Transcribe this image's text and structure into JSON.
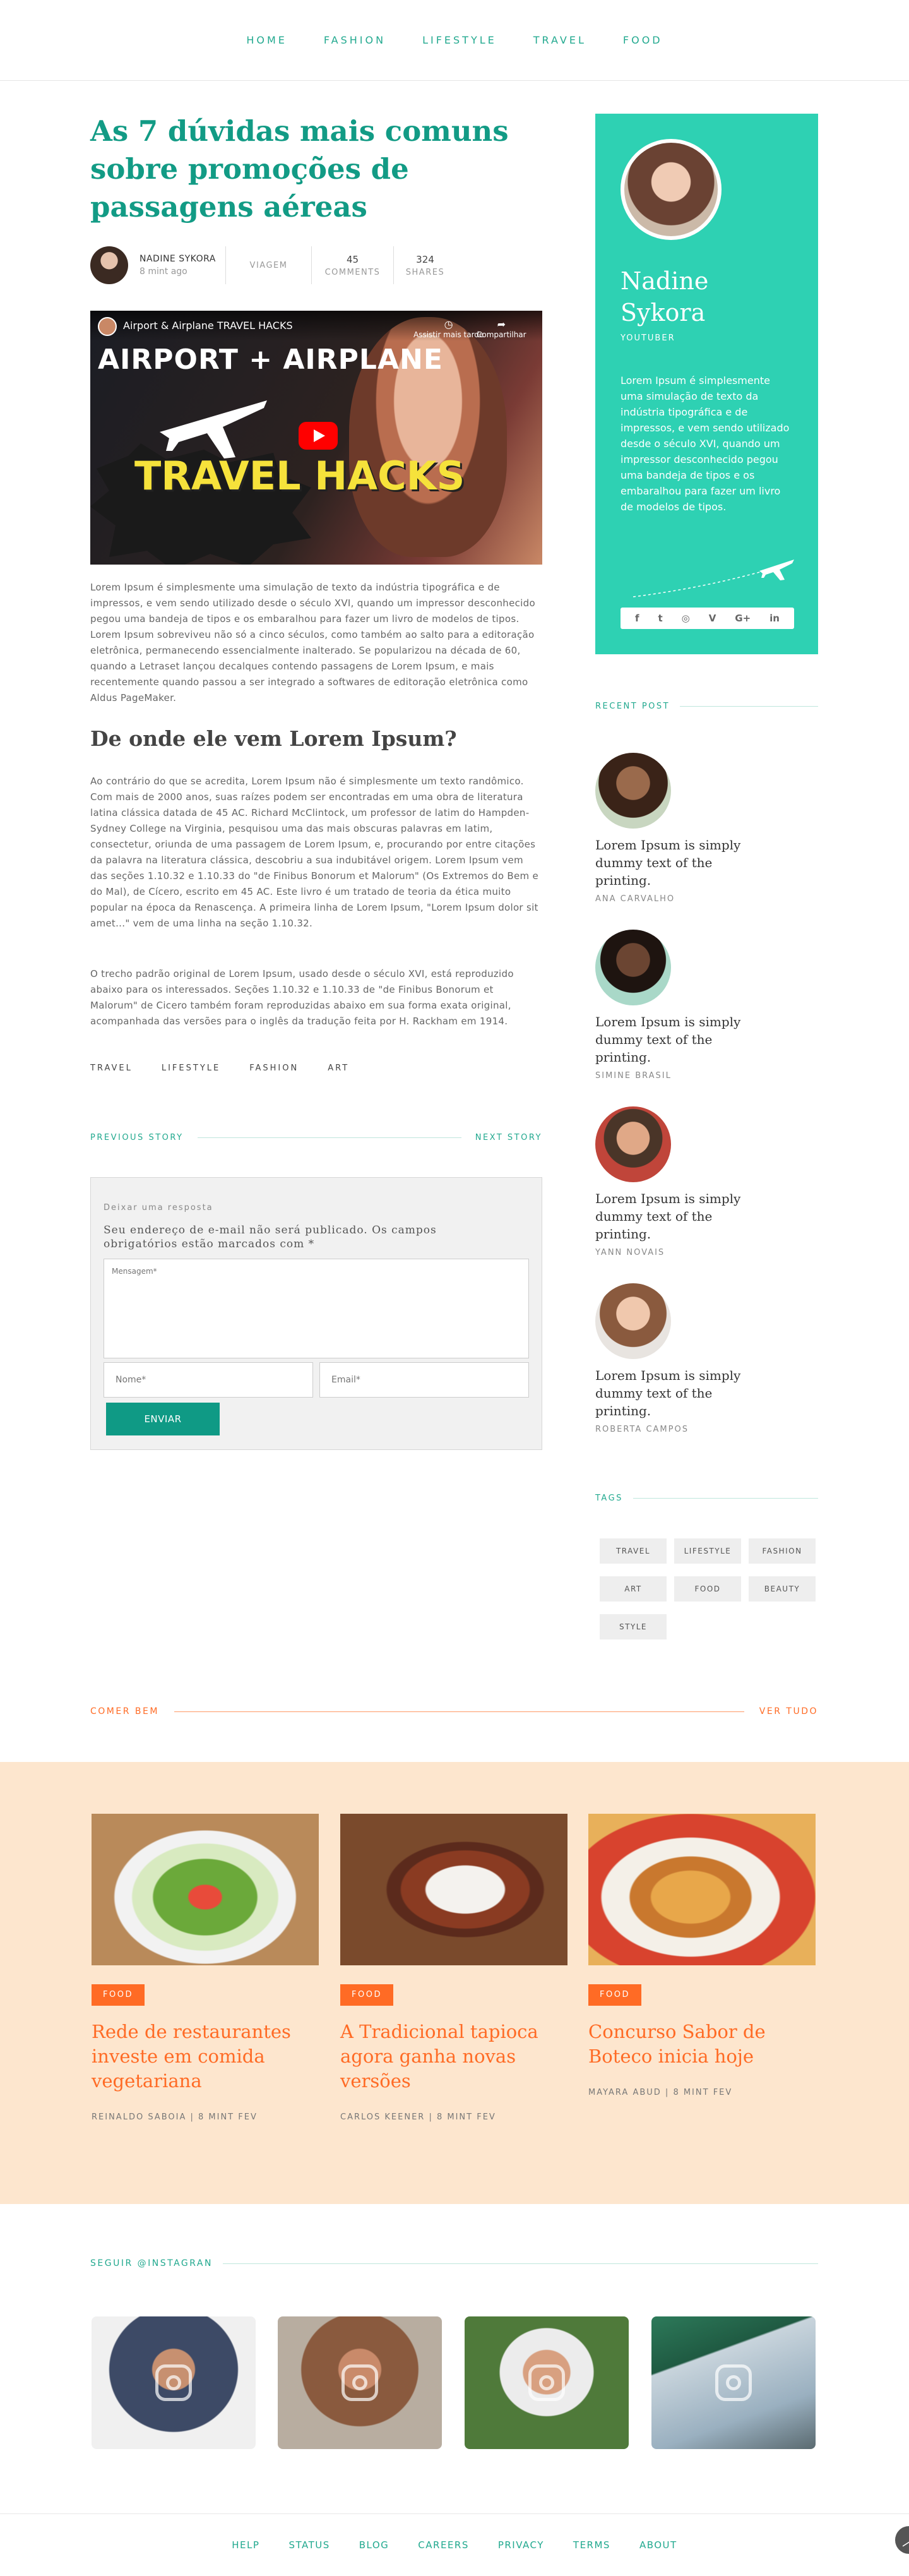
{
  "nav": [
    "HOME",
    "FASHION",
    "LIFESTYLE",
    "TRAVEL",
    "FOOD"
  ],
  "post": {
    "title": "As 7 dúvidas mais comuns sobre promoções de passagens aéreas",
    "author": "NADINE SYKORA",
    "time": "8 mint ago",
    "category": "VIAGEM",
    "comments_count": "45",
    "comments_label": "COMMENTS",
    "shares_count": "324",
    "shares_label": "SHARES",
    "video": {
      "title": "Airport & Airplane TRAVEL HACKS",
      "watch_later": "Assistir mais tarde",
      "share": "Compartilhar",
      "headline_1": "AIRPORT + AIRPLANE",
      "headline_2": "TRAVEL HACKS"
    },
    "para1": "Lorem Ipsum é simplesmente uma simulação de texto da indústria tipográfica e de impressos, e vem sendo utilizado desde o século XVI, quando um impressor desconhecido pegou uma bandeja de tipos e os embaralhou para fazer um livro de modelos de tipos. Lorem Ipsum sobreviveu não só a cinco séculos, como também ao salto para a editoração eletrônica, permanecendo essencialmente inalterado. Se popularizou na década de 60, quando a Letraset lançou decalques contendo passagens de Lorem Ipsum, e mais recentemente quando passou a ser integrado a softwares de editoração eletrônica como Aldus PageMaker.",
    "subheading": "De onde ele vem Lorem Ipsum?",
    "para2": "Ao contrário do que se acredita, Lorem Ipsum não é simplesmente um texto randômico. Com mais de 2000 anos, suas raízes podem ser encontradas em uma obra de literatura latina clássica datada de 45 AC. Richard McClintock, um professor de latim do Hampden-Sydney College na Virginia, pesquisou uma das mais obscuras palavras em latim, consectetur, oriunda de uma passagem de Lorem Ipsum, e, procurando por entre citações da palavra na literatura clássica, descobriu a sua indubitável origem. Lorem Ipsum vem das seções 1.10.32 e 1.10.33 do \"de Finibus Bonorum et Malorum\" (Os Extremos do Bem e do Mal), de Cícero, escrito em 45 AC. Este livro é um tratado de teoria da ética muito popular na época da Renascença. A primeira linha de Lorem Ipsum, \"Lorem Ipsum dolor sit amet...\" vem de uma linha na seção 1.10.32.",
    "para3": "O trecho padrão original de Lorem Ipsum, usado desde o século XVI, está reproduzido abaixo para os interessados. Seções 1.10.32 e 1.10.33 de \"de Finibus Bonorum et Malorum\" de Cicero também foram reproduzidas abaixo em sua forma exata original, acompanhada das versões para o inglês da tradução feita por H. Rackham em 1914.",
    "tags": [
      "TRAVEL",
      "LIFESTYLE",
      "FASHION",
      "ART"
    ],
    "prev": "PREVIOUS STORY",
    "next": "NEXT STORY"
  },
  "reply": {
    "label": "Deixar uma resposta",
    "note": "Seu endereço de e-mail não será publicado. Os campos obrigatórios estão marcados com *",
    "message_placeholder": "Mensagem*",
    "name_placeholder": "Nome*",
    "email_placeholder": "Email*",
    "submit": "ENVIAR"
  },
  "profile": {
    "name": "Nadine Sykora",
    "role": "YOUTUBER",
    "bio": "Lorem Ipsum é simplesmente uma simulação de texto da indústria tipográfica e de impressos, e vem sendo utilizado desde o século XVI, quando um impressor desconhecido pegou uma bandeja de tipos e os embaralhou para fazer um livro de modelos de tipos.",
    "social": [
      "f",
      "t",
      "◎",
      "V",
      "G+",
      "in"
    ]
  },
  "recent": {
    "heading": "RECENT POST",
    "items": [
      {
        "title": "Lorem Ipsum is simply dummy text of the printing.",
        "author": "ANA CARVALHO"
      },
      {
        "title": "Lorem Ipsum is simply dummy text of the printing.",
        "author": "SIMINE BRASIL"
      },
      {
        "title": "Lorem Ipsum is simply dummy text of the printing.",
        "author": "YANN NOVAIS"
      },
      {
        "title": "Lorem Ipsum is simply dummy text of the printing.",
        "author": "ROBERTA CAMPOS"
      }
    ]
  },
  "tags": {
    "heading": "TAGS",
    "items": [
      "TRAVEL",
      "LIFESTYLE",
      "FASHION",
      "ART",
      "FOOD",
      "BEAUTY",
      "STYLE"
    ]
  },
  "food": {
    "heading": "COMER BEM",
    "see_all": "VER TUDO",
    "cards": [
      {
        "badge": "FOOD",
        "title": "Rede de restaurantes investe em comida vegetariana",
        "meta": "REINALDO SABOIA | 8 MINT FEV"
      },
      {
        "badge": "FOOD",
        "title": "A Tradicional tapioca agora ganha novas versões",
        "meta": "CARLOS KEENER | 8 MINT FEV"
      },
      {
        "badge": "FOOD",
        "title": "Concurso Sabor de Boteco inicia hoje",
        "meta": "MAYARA ABUD | 8 MINT FEV"
      }
    ]
  },
  "instagram": {
    "heading": "SEGUIR @INSTAGRAN"
  },
  "footer": [
    "HELP",
    "STATUS",
    "BLOG",
    "CAREERS",
    "PRIVACY",
    "TERMS",
    "ABOUT"
  ],
  "colors": {
    "accent": "#22a98f",
    "profile_bg": "#2ed1b3",
    "food_accent": "#ff6b25",
    "food_band": "#fde6ce"
  }
}
